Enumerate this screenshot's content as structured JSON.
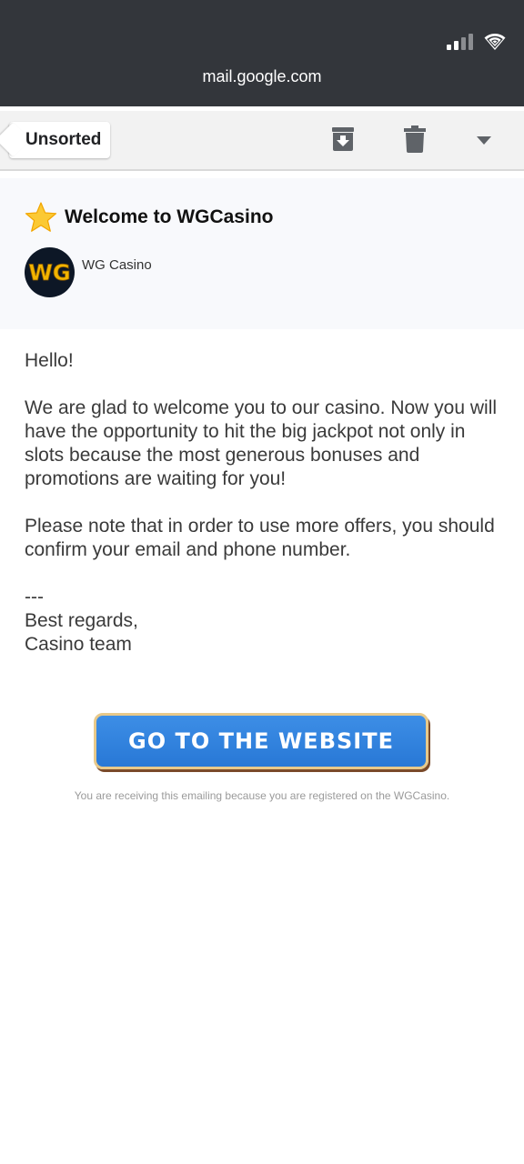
{
  "browser": {
    "url": "mail.google.com"
  },
  "toolbar": {
    "back_label": "Unsorted"
  },
  "email": {
    "subject": "Welcome to WGCasino",
    "sender_name": "WG Casino",
    "avatar_text": "WG",
    "greeting": "Hello!",
    "paragraph_1": "We are glad to welcome you to our casino. Now you will have the opportunity to hit the big jackpot not only in slots because the most generous bonuses and promotions are waiting for you!",
    "paragraph_2": "Please note that in order to use more offers, you should confirm your email and phone number.",
    "separator": "---",
    "signoff": "Best regards,",
    "signature": "Casino team",
    "cta_label": "GO TO THE WEBSITE",
    "footer_note": "You are receiving this emailing because you are registered on the WGCasino."
  },
  "icons": {
    "signal": "signal-icon",
    "wifi": "wifi-icon",
    "archive": "archive-icon",
    "trash": "trash-icon",
    "more": "chevron-down-icon",
    "subject_star": "star-icon"
  },
  "colors": {
    "topbar": "#33363b",
    "cta_blue": "#2e80dc",
    "cta_border": "#e8c98a",
    "avatar_bg": "#0d1726",
    "avatar_letters": "#f2b400"
  }
}
